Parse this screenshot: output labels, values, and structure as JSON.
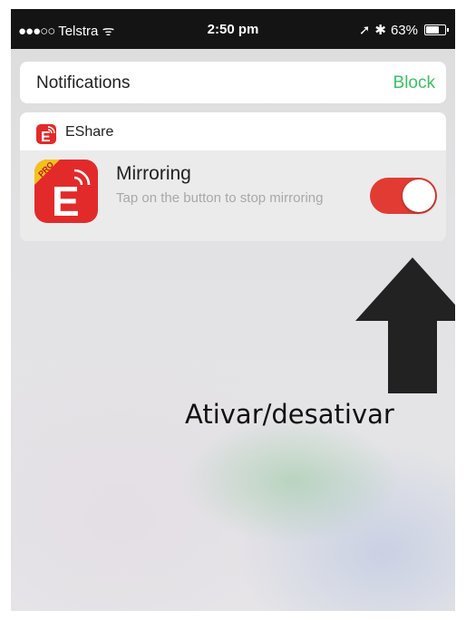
{
  "status_bar": {
    "signal_dots": "●●●○○",
    "carrier": "Telstra",
    "wifi_symbol": "ᯤ",
    "time": "2:50 pm",
    "location_symbol": "➚",
    "bluetooth_symbol": "✱",
    "battery_percent": "63%"
  },
  "notifications_header": {
    "title": "Notifications",
    "block_label": "Block"
  },
  "widget": {
    "app_name": "EShare",
    "title": "Mirroring",
    "description": "Tap on the button to stop mirroring",
    "toggle_on": true,
    "badge": "PRO"
  },
  "annotation": {
    "caption": "Ativar/desativar"
  },
  "colors": {
    "status_bar_bg": "#141414",
    "block_green": "#3cc063",
    "app_red": "#e32a2a",
    "toggle_red": "#e23b34",
    "arrow": "#222222"
  },
  "icons": [
    "wifi-icon",
    "location-icon",
    "bluetooth-icon",
    "battery-icon",
    "eshare-app-icon",
    "eshare-pro-app-icon",
    "up-arrow-icon"
  ]
}
